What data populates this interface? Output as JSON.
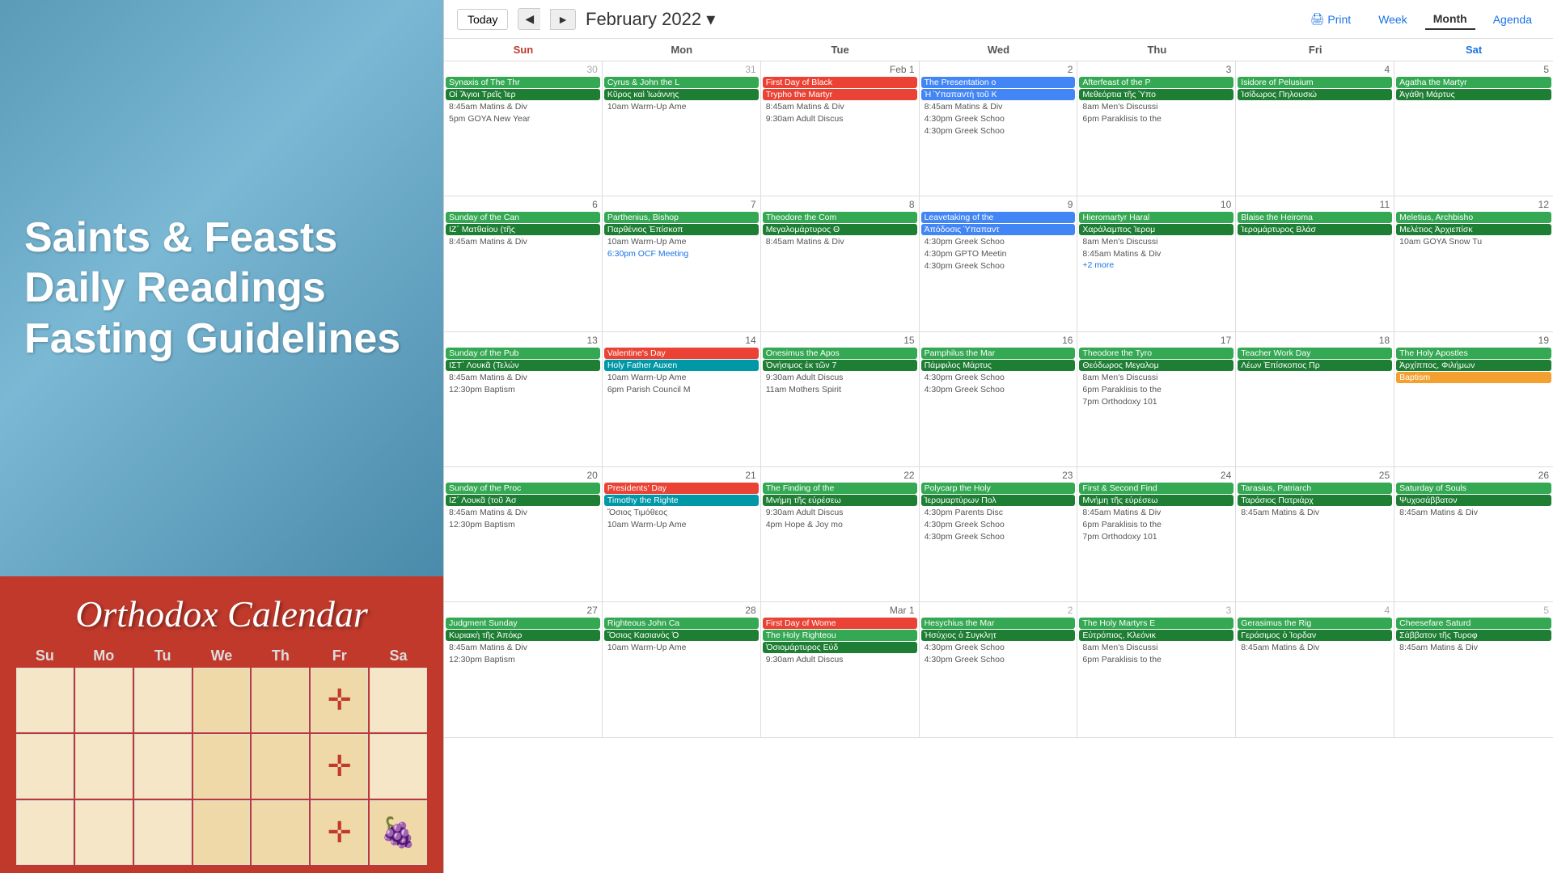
{
  "left": {
    "lines": [
      "Saints & Feasts",
      "Daily Readings",
      "Fasting Guidelines"
    ],
    "calendar_title": "Orthodox Calendar",
    "mini_days": [
      "Su",
      "Mo",
      "Tu",
      "We",
      "Th",
      "Fr",
      "Sa"
    ]
  },
  "header": {
    "today_label": "Today",
    "prev_label": "◄",
    "next_label": "►",
    "month_title": "February 2022",
    "print_label": "Print",
    "week_label": "Week",
    "month_label": "Month",
    "agenda_label": "Agenda"
  },
  "day_headers": [
    "Sun",
    "Mon",
    "Tue",
    "Wed",
    "Thu",
    "Fri",
    "Sat"
  ],
  "weeks": [
    {
      "days": [
        {
          "num": "30",
          "other": true,
          "events": [
            {
              "type": "green",
              "text": "Synaxis of The Thr"
            },
            {
              "type": "dark-green",
              "text": "Οἱ Ἅγιοι Τρεῖς Ἱερ"
            },
            {
              "type": "gray-text",
              "text": "8:45am Matins & Div"
            },
            {
              "type": "gray-text",
              "text": "5pm GOYA New Year"
            }
          ]
        },
        {
          "num": "31",
          "other": true,
          "events": [
            {
              "type": "green",
              "text": "Cyrus & John the L"
            },
            {
              "type": "dark-green",
              "text": "Κῦρος καὶ Ἰωάννης"
            },
            {
              "type": "gray-text",
              "text": "10am Warm-Up Ame"
            }
          ]
        },
        {
          "num": "Feb 1",
          "first": true,
          "events": [
            {
              "type": "red",
              "text": "First Day of Black"
            },
            {
              "type": "red",
              "text": "Trypho the Martyr"
            },
            {
              "type": "gray-text",
              "text": "8:45am Matins & Div"
            },
            {
              "type": "gray-text",
              "text": "9:30am Adult Discus"
            }
          ]
        },
        {
          "num": "2",
          "events": [
            {
              "type": "blue",
              "text": "The Presentation o"
            },
            {
              "type": "blue",
              "text": "Ἡ Ὑπαπαντὴ τοῦ Κ"
            },
            {
              "type": "gray-text",
              "text": "8:45am Matins & Div"
            },
            {
              "type": "gray-text",
              "text": "4:30pm Greek Schoo"
            },
            {
              "type": "gray-text",
              "text": "4:30pm Greek Schoo"
            }
          ]
        },
        {
          "num": "3",
          "events": [
            {
              "type": "green",
              "text": "Afterfeast of the P"
            },
            {
              "type": "dark-green",
              "text": "Μεθεόρτια τῆς Ὑπο"
            },
            {
              "type": "gray-text",
              "text": "8am Men's Discussi"
            },
            {
              "type": "gray-text",
              "text": "6pm Paraklisis to the"
            }
          ]
        },
        {
          "num": "4",
          "events": [
            {
              "type": "green",
              "text": "Isidore of Pelusium"
            },
            {
              "type": "dark-green",
              "text": "Ἰσίδωρος Πηλουσιώ"
            }
          ]
        },
        {
          "num": "5",
          "events": [
            {
              "type": "green",
              "text": "Agatha the Martyr"
            },
            {
              "type": "dark-green",
              "text": "Ἀγάθη Μάρτυς"
            }
          ]
        }
      ]
    },
    {
      "days": [
        {
          "num": "6",
          "events": [
            {
              "type": "green",
              "text": "Sunday of the Can"
            },
            {
              "type": "dark-green",
              "text": "ΙΖ΄ Ματθαίου (τῆς"
            },
            {
              "type": "gray-text",
              "text": "8:45am Matins & Div"
            }
          ]
        },
        {
          "num": "7",
          "events": [
            {
              "type": "green",
              "text": "Parthenius, Bishop"
            },
            {
              "type": "dark-green",
              "text": "Παρθένιος Ἐπίσκοπ"
            },
            {
              "type": "gray-text",
              "text": "10am Warm-Up Ame"
            },
            {
              "type": "blue-text",
              "text": "6:30pm OCF Meeting"
            }
          ]
        },
        {
          "num": "8",
          "events": [
            {
              "type": "green",
              "text": "Theodore the Com"
            },
            {
              "type": "dark-green",
              "text": "Μεγαλομάρτυρος Θ"
            },
            {
              "type": "gray-text",
              "text": "8:45am Matins & Div"
            }
          ]
        },
        {
          "num": "9",
          "events": [
            {
              "type": "blue",
              "text": "Leavetaking of the"
            },
            {
              "type": "blue",
              "text": "Ἀπόδοσις Ὑπαπαντ"
            },
            {
              "type": "gray-text",
              "text": "4:30pm Greek Schoo"
            },
            {
              "type": "gray-text",
              "text": "4:30pm GPTO Meetin"
            },
            {
              "type": "gray-text",
              "text": "4:30pm Greek Schoo"
            }
          ]
        },
        {
          "num": "10",
          "events": [
            {
              "type": "green",
              "text": "Hieromartyr Haral"
            },
            {
              "type": "dark-green",
              "text": "Χαράλαμπος Ἱερομ"
            },
            {
              "type": "gray-text",
              "text": "8am Men's Discussi"
            },
            {
              "type": "gray-text",
              "text": "8:45am Matins & Div"
            },
            {
              "type": "more",
              "text": "+2 more"
            }
          ]
        },
        {
          "num": "11",
          "events": [
            {
              "type": "green",
              "text": "Blaise the Heiroma"
            },
            {
              "type": "dark-green",
              "text": "Ἱερομάρτυρος Βλάσ"
            }
          ]
        },
        {
          "num": "12",
          "events": [
            {
              "type": "green",
              "text": "Meletius, Archbisho"
            },
            {
              "type": "dark-green",
              "text": "Μελέτιος Ἀρχιεπίσκ"
            },
            {
              "type": "gray-text",
              "text": "10am GOYA Snow Tu"
            }
          ]
        }
      ]
    },
    {
      "days": [
        {
          "num": "13",
          "events": [
            {
              "type": "green",
              "text": "Sunday of the Pub"
            },
            {
              "type": "dark-green",
              "text": "ΙΣΤ΄ Λουκᾶ (Τελών"
            },
            {
              "type": "gray-text",
              "text": "8:45am Matins & Div"
            },
            {
              "type": "gray-text",
              "text": "12:30pm Baptism"
            }
          ]
        },
        {
          "num": "14",
          "events": [
            {
              "type": "red",
              "text": "Valentine's Day"
            },
            {
              "type": "teal",
              "text": "Holy Father Auxen"
            },
            {
              "type": "gray-text",
              "text": "10am Warm-Up Ame"
            },
            {
              "type": "gray-text",
              "text": "6pm Parish Council M"
            }
          ]
        },
        {
          "num": "15",
          "events": [
            {
              "type": "green",
              "text": "Onesimus the Apos"
            },
            {
              "type": "dark-green",
              "text": "Ὀνήσιμος ἐκ τῶν 7"
            },
            {
              "type": "gray-text",
              "text": "9:30am Adult Discus"
            },
            {
              "type": "gray-text",
              "text": "11am Mothers Spirit"
            }
          ]
        },
        {
          "num": "16",
          "events": [
            {
              "type": "green",
              "text": "Pamphilus the Mar"
            },
            {
              "type": "dark-green",
              "text": "Πάμφιλος Μάρτυς"
            },
            {
              "type": "gray-text",
              "text": "4:30pm Greek Schoo"
            },
            {
              "type": "gray-text",
              "text": "4:30pm Greek Schoo"
            }
          ]
        },
        {
          "num": "17",
          "events": [
            {
              "type": "green",
              "text": "Theodore the Tyro"
            },
            {
              "type": "dark-green",
              "text": "Θεόδωρος Μεγαλομ"
            },
            {
              "type": "gray-text",
              "text": "8am Men's Discussi"
            },
            {
              "type": "gray-text",
              "text": "6pm Paraklisis to the"
            },
            {
              "type": "gray-text",
              "text": "7pm Orthodoxy 101"
            }
          ]
        },
        {
          "num": "18",
          "events": [
            {
              "type": "green",
              "text": "Teacher Work Day"
            },
            {
              "type": "dark-green",
              "text": "Λέων Ἐπίσκοπος Πρ"
            }
          ]
        },
        {
          "num": "19",
          "events": [
            {
              "type": "green",
              "text": "The Holy Apostles"
            },
            {
              "type": "dark-green",
              "text": "Ἀρχίππος, Φιλήμων"
            },
            {
              "type": "orange",
              "text": "Baptism"
            }
          ]
        }
      ]
    },
    {
      "days": [
        {
          "num": "20",
          "events": [
            {
              "type": "green",
              "text": "Sunday of the Proc"
            },
            {
              "type": "dark-green",
              "text": "ΙΖ΄ Λουκᾶ (τοῦ Ἀσ"
            },
            {
              "type": "gray-text",
              "text": "8:45am Matins & Div"
            },
            {
              "type": "gray-text",
              "text": "12:30pm Baptism"
            }
          ]
        },
        {
          "num": "21",
          "events": [
            {
              "type": "red",
              "text": "Presidents' Day"
            },
            {
              "type": "teal",
              "text": "Timothy the Righte"
            },
            {
              "type": "gray-text",
              "text": "Ὅσιος Τιμόθεος"
            },
            {
              "type": "gray-text",
              "text": "10am Warm-Up Ame"
            }
          ]
        },
        {
          "num": "22",
          "events": [
            {
              "type": "green",
              "text": "The Finding of the"
            },
            {
              "type": "dark-green",
              "text": "Μνήμη τῆς εὑρέσεω"
            },
            {
              "type": "gray-text",
              "text": "9:30am Adult Discus"
            },
            {
              "type": "gray-text",
              "text": "4pm Hope & Joy mo"
            }
          ]
        },
        {
          "num": "23",
          "events": [
            {
              "type": "green",
              "text": "Polycarp the Holy"
            },
            {
              "type": "dark-green",
              "text": "Ἱερομαρτύρων Πολ"
            },
            {
              "type": "gray-text",
              "text": "4:30pm Parents Disc"
            },
            {
              "type": "gray-text",
              "text": "4:30pm Greek Schoo"
            },
            {
              "type": "gray-text",
              "text": "4:30pm Greek Schoo"
            }
          ]
        },
        {
          "num": "24",
          "events": [
            {
              "type": "green",
              "text": "First & Second Find"
            },
            {
              "type": "dark-green",
              "text": "Μνήμη τῆς εὑρέσεω"
            },
            {
              "type": "gray-text",
              "text": "8:45am Matins & Div"
            },
            {
              "type": "gray-text",
              "text": "6pm Paraklisis to the"
            },
            {
              "type": "gray-text",
              "text": "7pm Orthodoxy 101"
            }
          ]
        },
        {
          "num": "25",
          "events": [
            {
              "type": "green",
              "text": "Tarasius, Patriarch"
            },
            {
              "type": "dark-green",
              "text": "Ταράσιος Πατριάρχ"
            },
            {
              "type": "gray-text",
              "text": "8:45am Matins & Div"
            }
          ]
        },
        {
          "num": "26",
          "events": [
            {
              "type": "green",
              "text": "Saturday of Souls"
            },
            {
              "type": "dark-green",
              "text": "Ψυχοσάββατον"
            },
            {
              "type": "gray-text",
              "text": "8:45am Matins & Div"
            }
          ]
        }
      ]
    },
    {
      "days": [
        {
          "num": "27",
          "events": [
            {
              "type": "green",
              "text": "Judgment Sunday"
            },
            {
              "type": "dark-green",
              "text": "Κυριακὴ τῆς Ἀπόκρ"
            },
            {
              "type": "gray-text",
              "text": "8:45am Matins & Div"
            },
            {
              "type": "gray-text",
              "text": "12:30pm Baptism"
            }
          ]
        },
        {
          "num": "28",
          "events": [
            {
              "type": "green",
              "text": "Righteous John Ca"
            },
            {
              "type": "dark-green",
              "text": "Ὅσιος Κασιανὸς Ὁ"
            },
            {
              "type": "gray-text",
              "text": "10am Warm-Up Ame"
            }
          ]
        },
        {
          "num": "Mar 1",
          "first": true,
          "events": [
            {
              "type": "red",
              "text": "First Day of Wome"
            },
            {
              "type": "green",
              "text": "The Holy Righteou"
            },
            {
              "type": "dark-green",
              "text": "Ὁσιομάρτυρος Εὐδ"
            },
            {
              "type": "gray-text",
              "text": "9:30am Adult Discus"
            }
          ]
        },
        {
          "num": "2",
          "other": true,
          "events": [
            {
              "type": "green",
              "text": "Hesychius the Mar"
            },
            {
              "type": "dark-green",
              "text": "Ἡσύχιος ὁ Συγκλητ"
            },
            {
              "type": "gray-text",
              "text": "4:30pm Greek Schoo"
            },
            {
              "type": "gray-text",
              "text": "4:30pm Greek Schoo"
            }
          ]
        },
        {
          "num": "3",
          "other": true,
          "events": [
            {
              "type": "green",
              "text": "The Holy Martyrs E"
            },
            {
              "type": "dark-green",
              "text": "Εὐτρόπιος, Κλεόνικ"
            },
            {
              "type": "gray-text",
              "text": "8am Men's Discussi"
            },
            {
              "type": "gray-text",
              "text": "6pm Paraklisis to the"
            }
          ]
        },
        {
          "num": "4",
          "other": true,
          "events": [
            {
              "type": "green",
              "text": "Gerasimus the Rig"
            },
            {
              "type": "dark-green",
              "text": "Γεράσιμος ὁ Ἰορδαν"
            },
            {
              "type": "gray-text",
              "text": "8:45am Matins & Div"
            }
          ]
        },
        {
          "num": "5",
          "other": true,
          "events": [
            {
              "type": "green",
              "text": "Cheesefare Saturd"
            },
            {
              "type": "dark-green",
              "text": "Σάββατον τῆς Τυροφ"
            },
            {
              "type": "gray-text",
              "text": "8:45am Matins & Div"
            }
          ]
        }
      ]
    }
  ]
}
